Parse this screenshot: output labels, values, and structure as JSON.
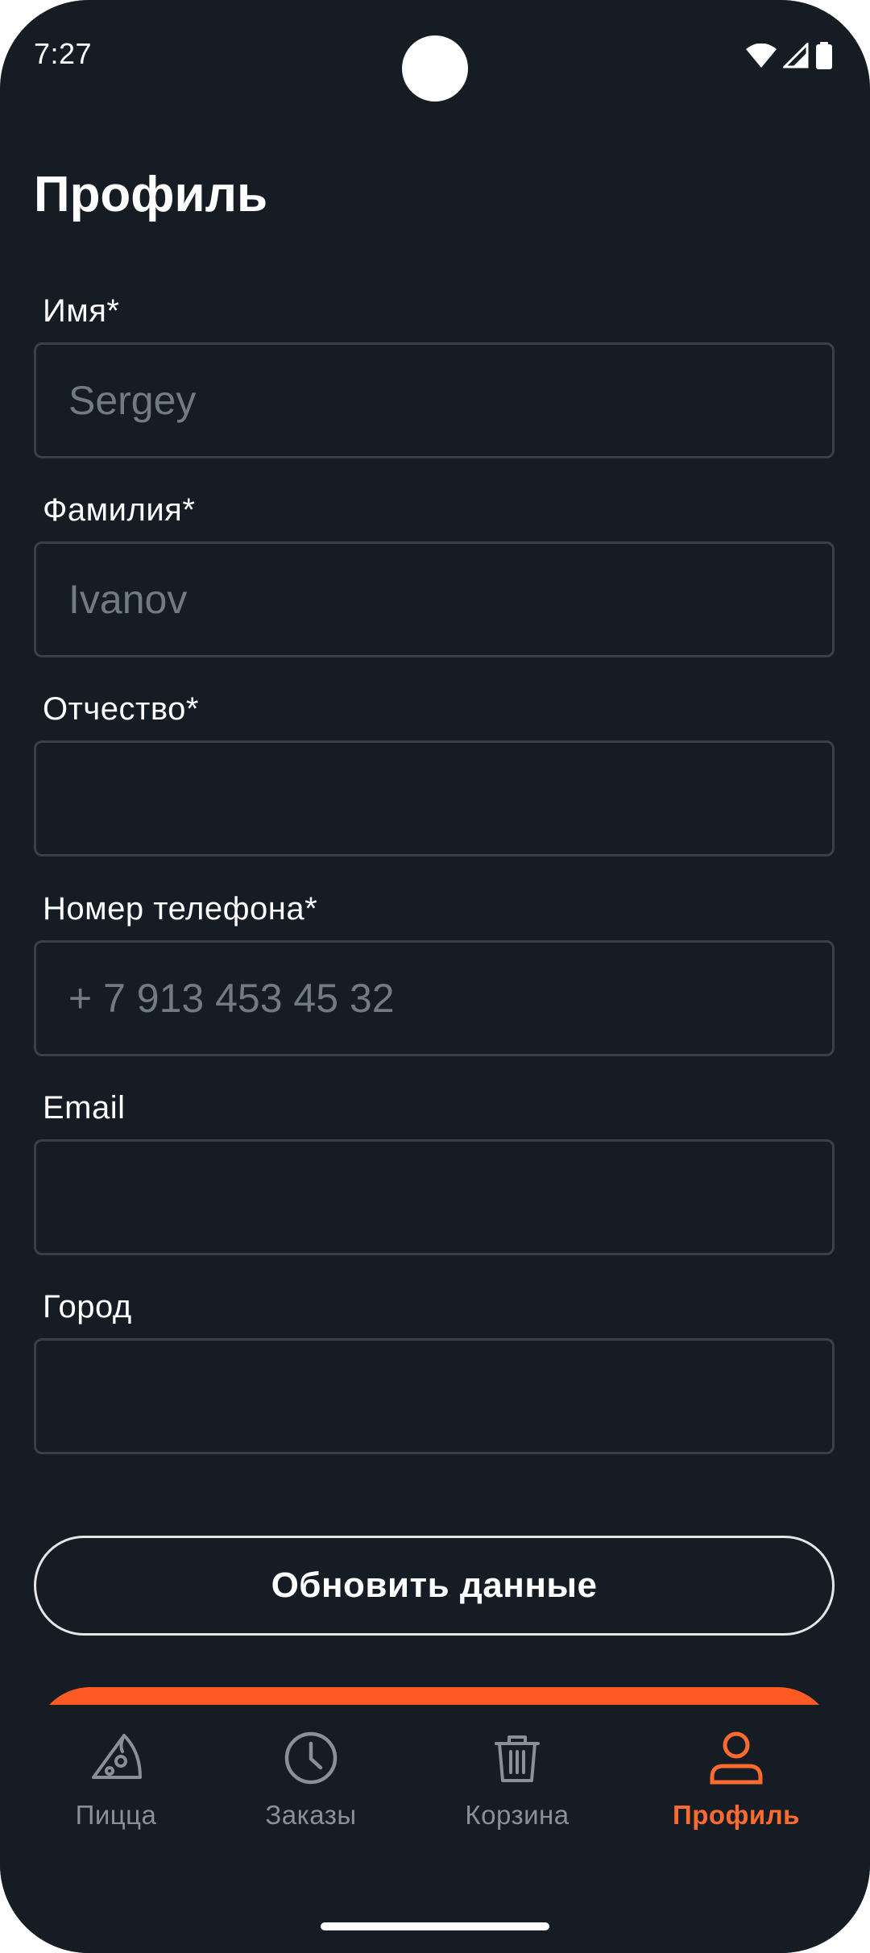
{
  "status_bar": {
    "time": "7:27",
    "icons": [
      "wifi-icon",
      "signal-icon",
      "battery-icon"
    ]
  },
  "page": {
    "title": "Профиль"
  },
  "form": {
    "first_name": {
      "label": "Имя*",
      "placeholder": "Sergey",
      "value": ""
    },
    "last_name": {
      "label": "Фамилия*",
      "placeholder": "Ivanov",
      "value": ""
    },
    "patronymic": {
      "label": "Отчество*",
      "placeholder": "",
      "value": ""
    },
    "phone": {
      "label": "Номер телефона*",
      "placeholder": "+ 7 913 453 45 32",
      "value": ""
    },
    "email": {
      "label": "Email",
      "placeholder": "",
      "value": ""
    },
    "city": {
      "label": "Город",
      "placeholder": "",
      "value": ""
    }
  },
  "actions": {
    "update_label": "Обновить данные"
  },
  "bottom_nav": {
    "items": [
      {
        "label": "Пицца",
        "icon": "pizza-icon",
        "active": false
      },
      {
        "label": "Заказы",
        "icon": "clock-icon",
        "active": false
      },
      {
        "label": "Корзина",
        "icon": "trash-basket-icon",
        "active": false
      },
      {
        "label": "Профиль",
        "icon": "user-icon",
        "active": true
      }
    ]
  },
  "colors": {
    "background": "#161c24",
    "accent": "#ff5a24",
    "input_border": "#3a4049",
    "placeholder": "#727a84",
    "nav_inactive": "#8a9098"
  }
}
